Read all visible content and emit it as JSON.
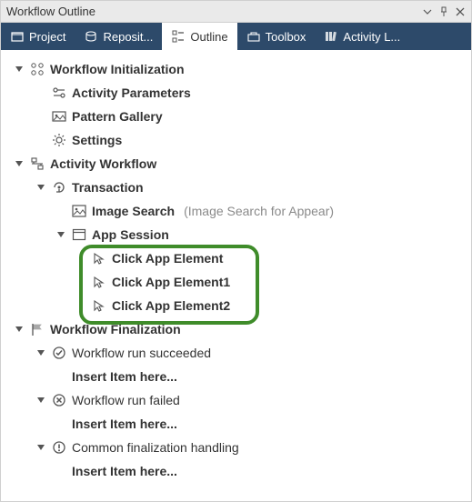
{
  "panel": {
    "title": "Workflow Outline"
  },
  "tabs": [
    {
      "label": "Project"
    },
    {
      "label": "Reposit..."
    },
    {
      "label": "Outline"
    },
    {
      "label": "Toolbox"
    },
    {
      "label": "Activity L..."
    }
  ],
  "tree": {
    "init": {
      "label": "Workflow Initialization",
      "params": "Activity Parameters",
      "gallery": "Pattern Gallery",
      "settings": "Settings"
    },
    "workflow": {
      "label": "Activity Workflow",
      "transaction": "Transaction",
      "imagesearch": {
        "label": "Image Search",
        "hint": "(Image Search for Appear)"
      },
      "appsession": "App Session",
      "clicks": [
        "Click App Element",
        "Click App Element1",
        "Click App Element2"
      ]
    },
    "final": {
      "label": "Workflow Finalization",
      "success": "Workflow run succeeded",
      "failed": "Workflow run failed",
      "common": "Common finalization handling",
      "insert": "Insert Item here..."
    }
  }
}
